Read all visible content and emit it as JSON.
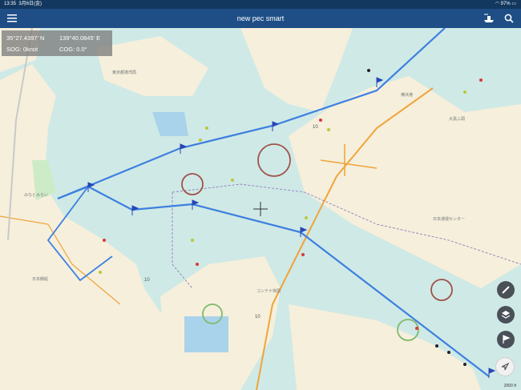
{
  "status_bar": {
    "time": "13:35",
    "date": "3月6日(金)",
    "battery": "97%"
  },
  "app_bar": {
    "title": "new pec smart",
    "menu_icon": "menu-icon",
    "search_icon": "search-icon",
    "ship_icon": "ship-icon"
  },
  "info": {
    "lat": "35°27.4397' N",
    "lon": "139°40.0845' E",
    "sog": "SOG: 0knot",
    "cog": "COG: 0.0°"
  },
  "map": {
    "labels": [
      {
        "name": "label-harbor-station",
        "text": "東京都港湾局"
      },
      {
        "name": "label-parking",
        "text": "日本郵船"
      },
      {
        "name": "label-warehouse",
        "text": "横浜港"
      },
      {
        "name": "label-wharf",
        "text": "大黒ふ頭"
      },
      {
        "name": "label-center",
        "text": "日本通運センター"
      },
      {
        "name": "label-cargo",
        "text": "コンテナ埠頭"
      },
      {
        "name": "label-city",
        "text": "みなとみらい"
      },
      {
        "name": "label-depth-1",
        "text": "10"
      },
      {
        "name": "label-depth-2",
        "text": "10"
      },
      {
        "name": "label-depth-3",
        "text": "10"
      }
    ],
    "route_color": "#3d7fe0",
    "land_color": "#f5efdc",
    "water_color": "#cfe9e6"
  },
  "controls": {
    "ruler_icon": "ruler-icon",
    "layers_icon": "layers-icon",
    "flag_icon": "flag-icon",
    "navigate_icon": "navigate-icon"
  },
  "scale": "2000 ft"
}
